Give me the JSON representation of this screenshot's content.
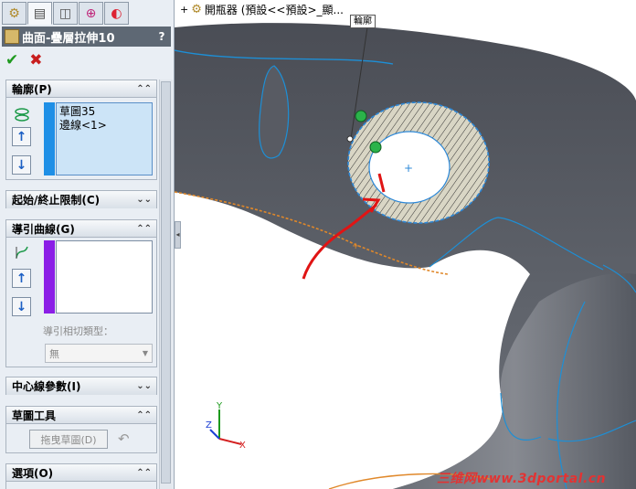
{
  "tabs": [
    {
      "name": "feature-manager-icon"
    },
    {
      "name": "property-manager-icon"
    },
    {
      "name": "configuration-manager-icon"
    },
    {
      "name": "dimxpert-icon"
    },
    {
      "name": "appearance-icon"
    }
  ],
  "title": {
    "label": "曲面-疊層拉伸10",
    "help": "?"
  },
  "actions": {
    "ok": "✔",
    "cancel": "✖"
  },
  "profile": {
    "header": "輪廓(P)",
    "items": [
      "草圖35",
      "邊線<1>"
    ]
  },
  "start_end": {
    "header": "起始/終止限制(C)"
  },
  "guide_curves": {
    "header": "導引曲線(G)",
    "tangency_label": "導引相切類型：",
    "tangency_value": "無"
  },
  "centerline": {
    "header": "中心線參數(I)"
  },
  "sketch_tools": {
    "header": "草圖工具",
    "drag_button": "拖曳草圖(D)"
  },
  "options": {
    "header": "選項(O)"
  },
  "viewport": {
    "breadcrumb": "開瓶器 (預設<<預設>_顯...",
    "callout": "輪廓",
    "watermark": "三维网www.3dportal.cn",
    "axes": {
      "x": "X",
      "y": "Y",
      "z": "Z"
    }
  },
  "colors": {
    "panel_bg": "#e9eef4",
    "titlebar": "#5e6874",
    "selection": "#cce4f7",
    "profile_bar": "#1e8fe6",
    "guide_bar": "#8b1ee6",
    "model": "#54575f",
    "edge": "#1d8fd6"
  }
}
